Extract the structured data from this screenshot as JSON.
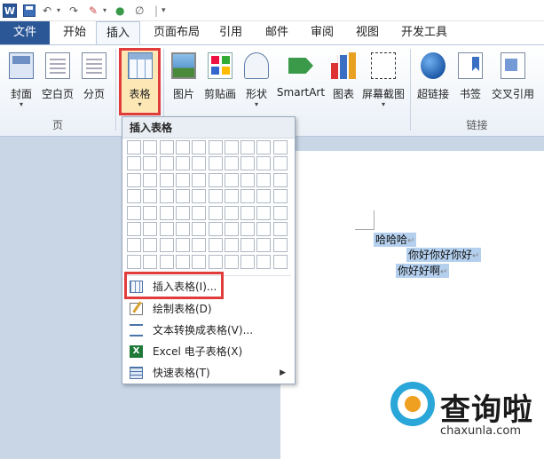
{
  "qat": {
    "logo": "W",
    "save_icon": "save-icon",
    "undo_icon": "undo-icon",
    "redo_icon": "redo-icon"
  },
  "tabs": [
    {
      "label": "文件"
    },
    {
      "label": "开始"
    },
    {
      "label": "插入"
    },
    {
      "label": "页面布局"
    },
    {
      "label": "引用"
    },
    {
      "label": "邮件"
    },
    {
      "label": "审阅"
    },
    {
      "label": "视图"
    },
    {
      "label": "开发工具"
    }
  ],
  "ribbon": {
    "pages_group": {
      "label": "页",
      "buttons": [
        {
          "label": "封面"
        },
        {
          "label": "空白页"
        },
        {
          "label": "分页"
        }
      ]
    },
    "tables_group": {
      "buttons": [
        {
          "label": "表格"
        }
      ]
    },
    "illustrations_group": {
      "buttons": [
        {
          "label": "图片"
        },
        {
          "label": "剪贴画"
        },
        {
          "label": "形状"
        },
        {
          "label": "SmartArt"
        },
        {
          "label": "图表"
        },
        {
          "label": "屏幕截图"
        }
      ]
    },
    "links_group": {
      "label": "链接",
      "buttons": [
        {
          "label": "超链接"
        },
        {
          "label": "书签"
        },
        {
          "label": "交叉引用"
        }
      ]
    }
  },
  "table_dropdown": {
    "header": "插入表格",
    "grid": {
      "columns": 10,
      "rows": 8
    },
    "items": [
      {
        "label": "插入表格(I)..."
      },
      {
        "label": "绘制表格(D)"
      },
      {
        "label": "文本转换成表格(V)..."
      },
      {
        "label": "Excel 电子表格(X)"
      },
      {
        "label": "快速表格(T)"
      }
    ]
  },
  "document": {
    "lines": [
      {
        "text": "哈哈哈"
      },
      {
        "text": "你好你好你好"
      },
      {
        "text": "你好好啊"
      }
    ],
    "paragraph_mark": "↵"
  },
  "watermark": {
    "brand": "查询啦",
    "url": "chaxunla.com"
  },
  "colors": {
    "accent": "#2b5797",
    "highlight_border": "#e03c3c",
    "selection": "#b4d0ee"
  }
}
